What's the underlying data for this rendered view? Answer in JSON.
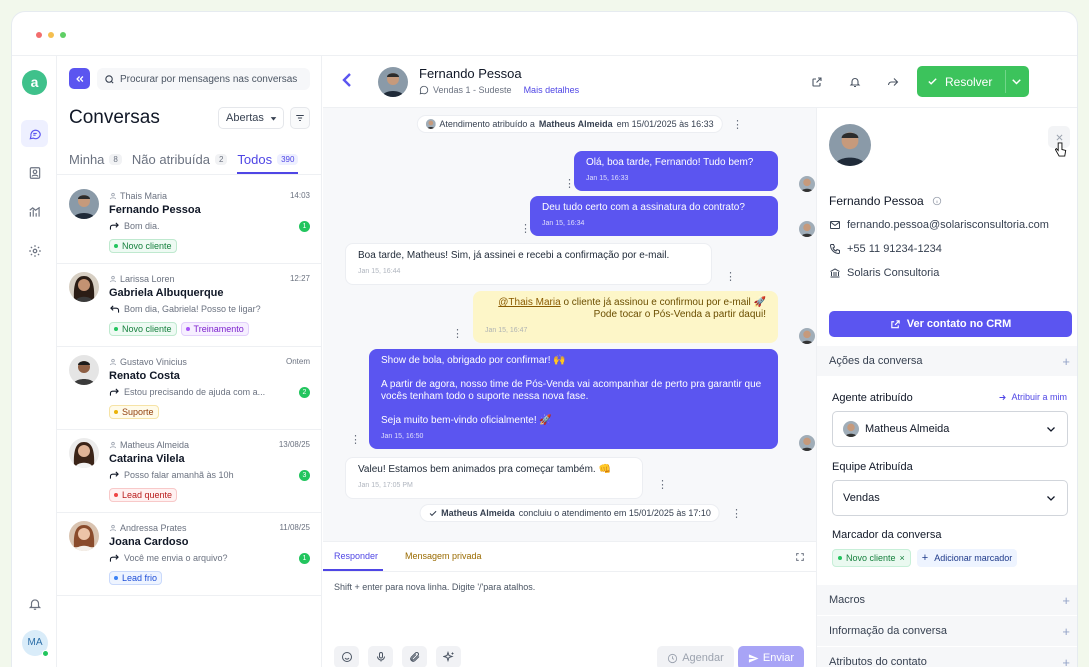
{
  "rail": {
    "logo": "a",
    "me_initials": "MA"
  },
  "search": {
    "placeholder": "Procurar por mensagens nas conversas"
  },
  "list": {
    "title": "Conversas",
    "status_filter": "Abertas",
    "tabs": [
      {
        "label": "Minha",
        "count": "8"
      },
      {
        "label": "Não atribuída",
        "count": "2"
      },
      {
        "label": "Todos",
        "count": "390"
      }
    ],
    "conversations": [
      {
        "agent": "Thais Maria",
        "time": "14:03",
        "name": "Fernando Pessoa",
        "preview": "Bom dia.",
        "unread": "1",
        "labels": [
          "Novo cliente"
        ]
      },
      {
        "agent": "Larissa Loren",
        "time": "12:27",
        "name": "Gabriela Albuquerque",
        "preview": "Bom dia, Gabriela! Posso te ligar?",
        "unread": "",
        "labels": [
          "Novo cliente",
          "Treinamento"
        ]
      },
      {
        "agent": "Gustavo Vinicius",
        "time": "Ontem",
        "name": "Renato Costa",
        "preview": "Estou precisando de ajuda com a...",
        "unread": "2",
        "labels": [
          "Suporte"
        ]
      },
      {
        "agent": "Matheus Almeida",
        "time": "13/08/25",
        "name": "Catarina Vilela",
        "preview": "Posso falar amanhã às 10h",
        "unread": "3",
        "labels": [
          "Lead quente"
        ]
      },
      {
        "agent": "Andressa Prates",
        "time": "11/08/25",
        "name": "Joana Cardoso",
        "preview": "Você me envia o arquivo?",
        "unread": "1",
        "labels": [
          "Lead frio"
        ]
      }
    ]
  },
  "chat": {
    "contact_name": "Fernando Pessoa",
    "inbox": "Vendas 1 - Sudeste",
    "more_details": "Mais detalhes",
    "resolve_label": "Resolver",
    "system_1": {
      "pre": "Atendimento atribuído a",
      "who": "Matheus Almeida",
      "post": "em 15/01/2025 às 16:33"
    },
    "messages": [
      {
        "text": "Olá, boa tarde, Fernando! Tudo bem?",
        "time": "Jan 15, 16:33"
      },
      {
        "text": "Deu tudo certo com a assinatura do contrato?",
        "time": "Jan 15, 16:34"
      },
      {
        "text": "Boa tarde, Matheus! Sim, já assinei e recebi a confirmação por e-mail.",
        "time": "Jan 15, 16:44"
      },
      {
        "mention": "@Thais Maria",
        "text_1": " o cliente já assinou e confirmou por e-mail 🚀",
        "text_2": "Pode tocar o Pós-Venda a partir daqui!",
        "time": "Jan 15, 16:47"
      },
      {
        "p1": "Show de bola, obrigado por confirmar! 🙌",
        "p2": "A partir de agora, nosso time de Pós-Venda vai acompanhar de perto pra garantir que vocês tenham todo o suporte nessa nova fase.",
        "p3": "Seja muito bem-vindo oficialmente! 🚀",
        "time": "Jan 15, 16:50"
      },
      {
        "text": "Valeu! Estamos bem animados pra começar também. 👊",
        "time": "Jan 15, 17:05 PM"
      }
    ],
    "system_2": {
      "who": "Matheus Almeida",
      "post": "concluiu o atendimento em 15/01/2025 às 17:10"
    },
    "composer": {
      "reply_tab": "Responder",
      "private_tab": "Mensagem privada",
      "placeholder": "Shift + enter para nova linha. Digite '/'para atalhos.",
      "schedule_label": "Agendar",
      "send_label": "Enviar"
    }
  },
  "contact": {
    "name": "Fernando Pessoa",
    "email": "fernando.pessoa@solarisconsultoria.com",
    "phone": "+55 11 91234-1234",
    "company": "Solaris Consultoria",
    "crm_button": "Ver contato no CRM",
    "actions_section": "Ações da conversa",
    "assigned_agent_label": "Agente atribuído",
    "assign_to_me": "Atribuir a mim",
    "assigned_agent": "Matheus Almeida",
    "team_label": "Equipe Atribuída",
    "team": "Vendas",
    "marker_label": "Marcador da conversa",
    "marker_tag": "Novo cliente",
    "add_marker": "Adicionar marcador",
    "sections": [
      "Macros",
      "Informação da conversa",
      "Atributos do contato"
    ]
  },
  "colors": {
    "accent": "#5b55f0",
    "resolve": "#3cc35c",
    "online": "#22c55e"
  }
}
